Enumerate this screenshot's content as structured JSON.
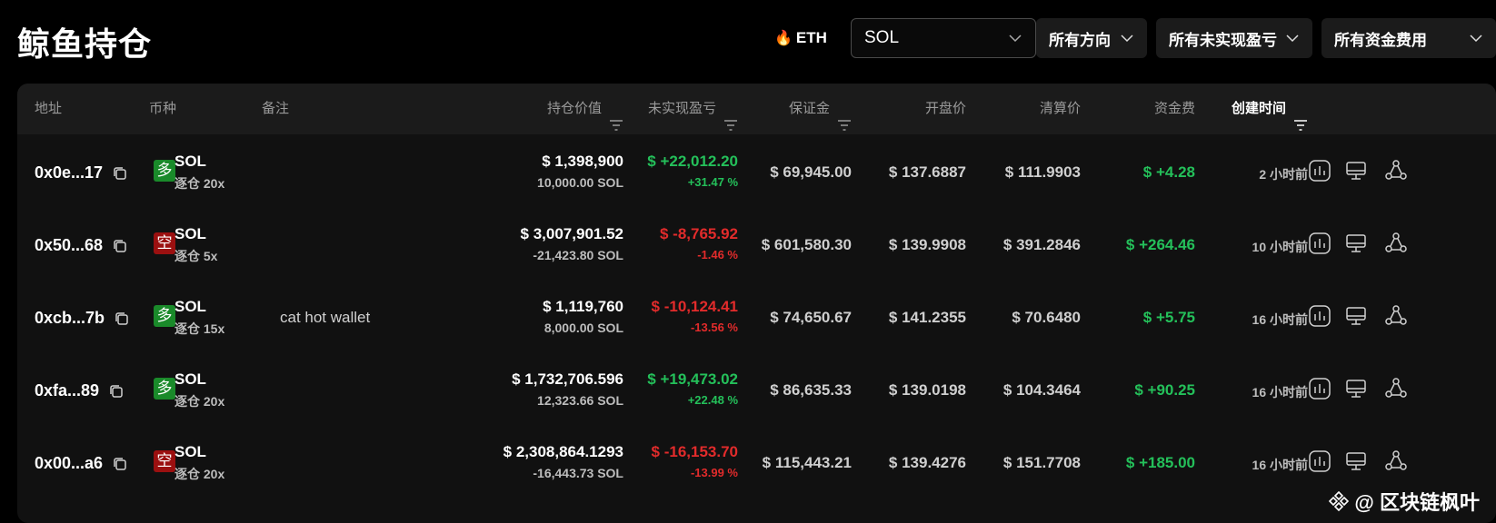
{
  "header": {
    "title": "鲸鱼持仓",
    "eth_label": "ETH",
    "coin_select": "SOL",
    "filters": [
      "所有方向",
      "所有未实现盈亏",
      "所有资金费用"
    ]
  },
  "table": {
    "columns": {
      "address": "地址",
      "coin": "币种",
      "note": "备注",
      "value": "持仓价值",
      "pnl": "未实现盈亏",
      "margin": "保证金",
      "open": "开盘价",
      "liq": "清算价",
      "funding": "资金费",
      "created": "创建时间"
    },
    "rows": [
      {
        "address": "0x0e...17",
        "side": "多",
        "side_type": "long",
        "coin": "SOL",
        "leverage": "逐仓 20x",
        "note": "",
        "value": "$ 1,398,900",
        "size": "10,000.00 SOL",
        "pnl": "$ +22,012.20",
        "pnl_pct": "+31.47 %",
        "pnl_type": "pos",
        "margin": "$ 69,945.00",
        "open": "$ 137.6887",
        "liq": "$ 111.9903",
        "funding": "$ +4.28",
        "created": "2 小时前"
      },
      {
        "address": "0x50...68",
        "side": "空",
        "side_type": "short",
        "coin": "SOL",
        "leverage": "逐仓 5x",
        "note": "",
        "value": "$ 3,007,901.52",
        "size": "-21,423.80 SOL",
        "pnl": "$ -8,765.92",
        "pnl_pct": "-1.46 %",
        "pnl_type": "neg",
        "margin": "$ 601,580.30",
        "open": "$ 139.9908",
        "liq": "$ 391.2846",
        "funding": "$ +264.46",
        "created": "10 小时前"
      },
      {
        "address": "0xcb...7b",
        "side": "多",
        "side_type": "long",
        "coin": "SOL",
        "leverage": "逐仓 15x",
        "note": "cat hot wallet",
        "value": "$ 1,119,760",
        "size": "8,000.00 SOL",
        "pnl": "$ -10,124.41",
        "pnl_pct": "-13.56 %",
        "pnl_type": "neg",
        "margin": "$ 74,650.67",
        "open": "$ 141.2355",
        "liq": "$ 70.6480",
        "funding": "$ +5.75",
        "created": "16 小时前"
      },
      {
        "address": "0xfa...89",
        "side": "多",
        "side_type": "long",
        "coin": "SOL",
        "leverage": "逐仓 20x",
        "note": "",
        "value": "$ 1,732,706.596",
        "size": "12,323.66 SOL",
        "pnl": "$ +19,473.02",
        "pnl_pct": "+22.48 %",
        "pnl_type": "pos",
        "margin": "$ 86,635.33",
        "open": "$ 139.0198",
        "liq": "$ 104.3464",
        "funding": "$ +90.25",
        "created": "16 小时前"
      },
      {
        "address": "0x00...a6",
        "side": "空",
        "side_type": "short",
        "coin": "SOL",
        "leverage": "逐仓 20x",
        "note": "",
        "value": "$ 2,308,864.1293",
        "size": "-16,443.73 SOL",
        "pnl": "$ -16,153.70",
        "pnl_pct": "-13.99 %",
        "pnl_type": "neg",
        "margin": "$ 115,443.21",
        "open": "$ 139.4276",
        "liq": "$ 151.7708",
        "funding": "$ +185.00",
        "created": "16 小时前"
      }
    ]
  },
  "watermark": "@ 区块链枫叶",
  "colors": {
    "positive": "#24c05a",
    "negative": "#e22b2b",
    "long_badge": "#1a8a2a",
    "short_badge": "#9b1010"
  }
}
